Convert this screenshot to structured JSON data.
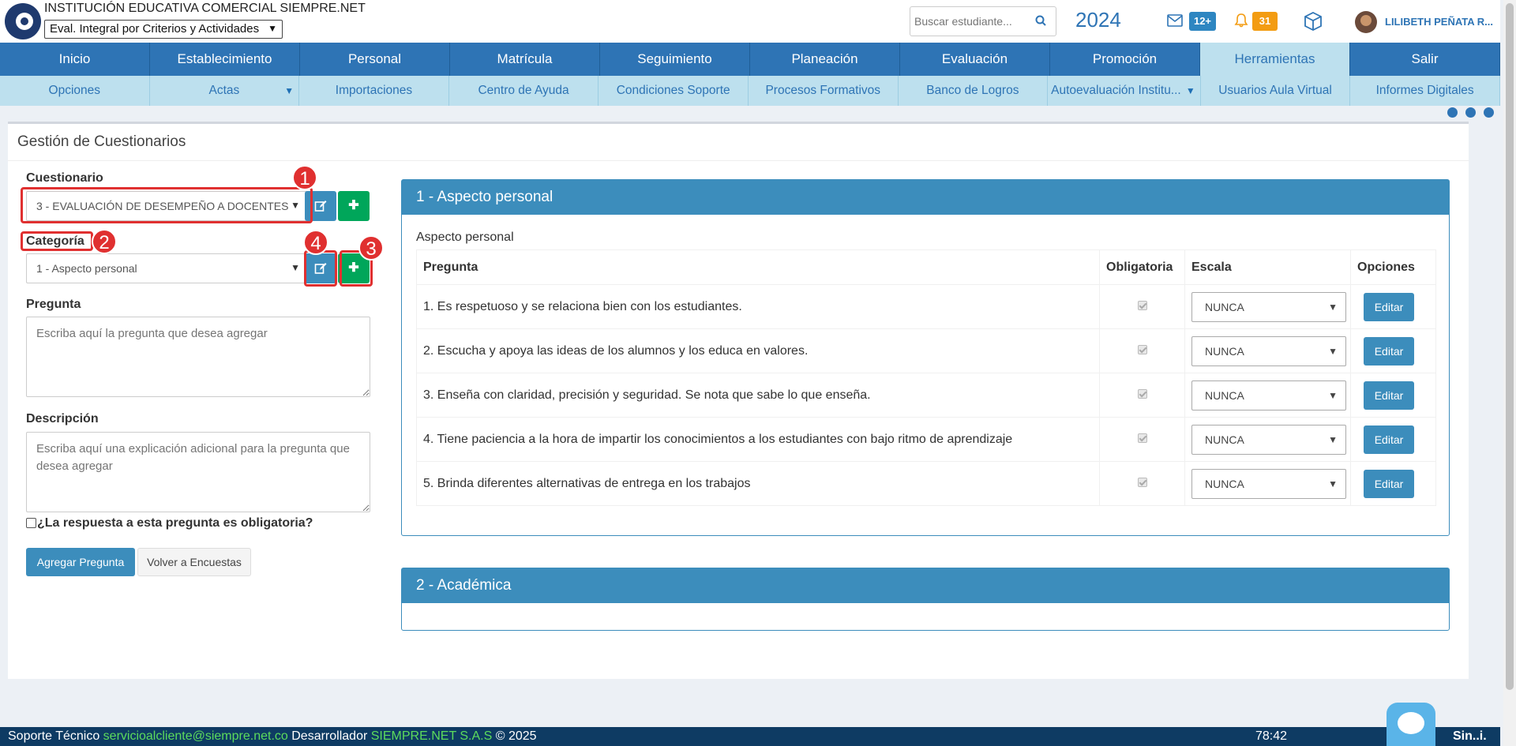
{
  "header": {
    "institution": "INSTITUCIÓN EDUCATIVA COMERCIAL SIEMPRE.NET",
    "mode_selected": "Eval. Integral por Criterios y Actividades",
    "search_placeholder": "Buscar estudiante...",
    "year": "2024",
    "mail_badge": "12+",
    "notif_badge": "31",
    "user_name": "LILIBETH PEÑATA R..."
  },
  "main_nav": [
    "Inicio",
    "Establecimiento",
    "Personal",
    "Matrícula",
    "Seguimiento",
    "Planeación",
    "Evaluación",
    "Promoción",
    "Herramientas",
    "Salir"
  ],
  "sub_nav": [
    "Opciones",
    "Actas",
    "Importaciones",
    "Centro de Ayuda",
    "Condiciones Soporte",
    "Procesos Formativos",
    "Banco de Logros",
    "Autoevaluación Institu...",
    "Usuarios Aula Virtual",
    "Informes Digitales"
  ],
  "page": {
    "title": "Gestión de Cuestionarios"
  },
  "form": {
    "cuestionario_label": "Cuestionario",
    "cuestionario_value": "3 - EVALUACIÓN DE DESEMPEÑO A DOCENTES",
    "categoria_label": "Categoría",
    "categoria_value": "1 - Aspecto personal",
    "pregunta_label": "Pregunta",
    "pregunta_placeholder": "Escriba aquí la pregunta que desea agregar",
    "descripcion_label": "Descripción",
    "descripcion_placeholder": "Escriba aquí una explicación adicional para la pregunta que desea agregar",
    "obligatoria_label": "¿La respuesta a esta pregunta es obligatoria?",
    "add_button": "Agregar Pregunta",
    "back_button": "Volver a Encuestas"
  },
  "callouts": [
    "1",
    "2",
    "3",
    "4"
  ],
  "sections": [
    {
      "header": "1 - Aspecto personal",
      "subtitle": "Aspecto personal",
      "columns": [
        "Pregunta",
        "Obligatoria",
        "Escala",
        "Opciones"
      ],
      "rows": [
        {
          "question": "1. Es respetuoso y se relaciona bien con los estudiantes.",
          "scale": "NUNCA",
          "action": "Editar"
        },
        {
          "question": "2. Escucha y apoya las ideas de los alumnos y los educa en valores.",
          "scale": "NUNCA",
          "action": "Editar"
        },
        {
          "question": "3. Enseña con claridad, precisión y seguridad. Se nota que sabe lo que enseña.",
          "scale": "NUNCA",
          "action": "Editar"
        },
        {
          "question": "4. Tiene paciencia a la hora de impartir los conocimientos a los estudiantes con bajo ritmo de aprendizaje",
          "scale": "NUNCA",
          "action": "Editar"
        },
        {
          "question": "5. Brinda diferentes alternativas de entrega en los trabajos",
          "scale": "NUNCA",
          "action": "Editar"
        }
      ]
    },
    {
      "header": "2 - Académica"
    }
  ],
  "footer": {
    "support_label": "Soporte Técnico",
    "support_email": "servicioalcliente@siempre.net.co",
    "dev_label": "Desarrollador",
    "dev_name": "SIEMPRE.NET S.A.S",
    "copyright": "© 2025",
    "timer": "78:42",
    "brand": "Sin..i."
  },
  "colors": {
    "primary": "#3c8dbc",
    "nav": "#2e74b5",
    "subnav": "#bde0ee",
    "success": "#00a65a",
    "callout": "#e03030",
    "footer": "#0e3b63"
  }
}
